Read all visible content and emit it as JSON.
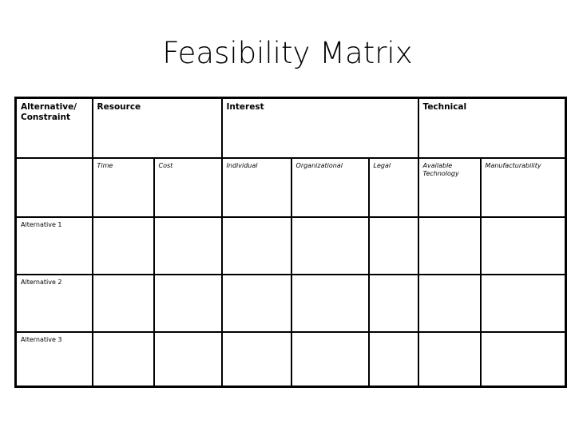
{
  "slide": {
    "title": "Feasibility Matrix"
  },
  "matrix": {
    "header_main": [
      {
        "label": "Alternative/\nConstraint",
        "span": 1
      },
      {
        "label": "Resource",
        "span": 2
      },
      {
        "label": "Interest",
        "span": 3
      },
      {
        "label": "Technical",
        "span": 2
      }
    ],
    "header_sub": [
      "",
      "Time",
      "Cost",
      "Individual",
      "Organizational",
      "Legal",
      "Available Technology",
      "Manufacturability"
    ],
    "rows": [
      {
        "label": "Alternative 1",
        "cells": [
          "",
          "",
          "",
          "",
          "",
          "",
          ""
        ]
      },
      {
        "label": "Alternative 2",
        "cells": [
          "",
          "",
          "",
          "",
          "",
          "",
          ""
        ]
      },
      {
        "label": "Alternative 3",
        "cells": [
          "",
          "",
          "",
          "",
          "",
          "",
          ""
        ]
      }
    ]
  },
  "colors": {
    "border": "#000000",
    "background": "#ffffff",
    "text": "#000000"
  }
}
